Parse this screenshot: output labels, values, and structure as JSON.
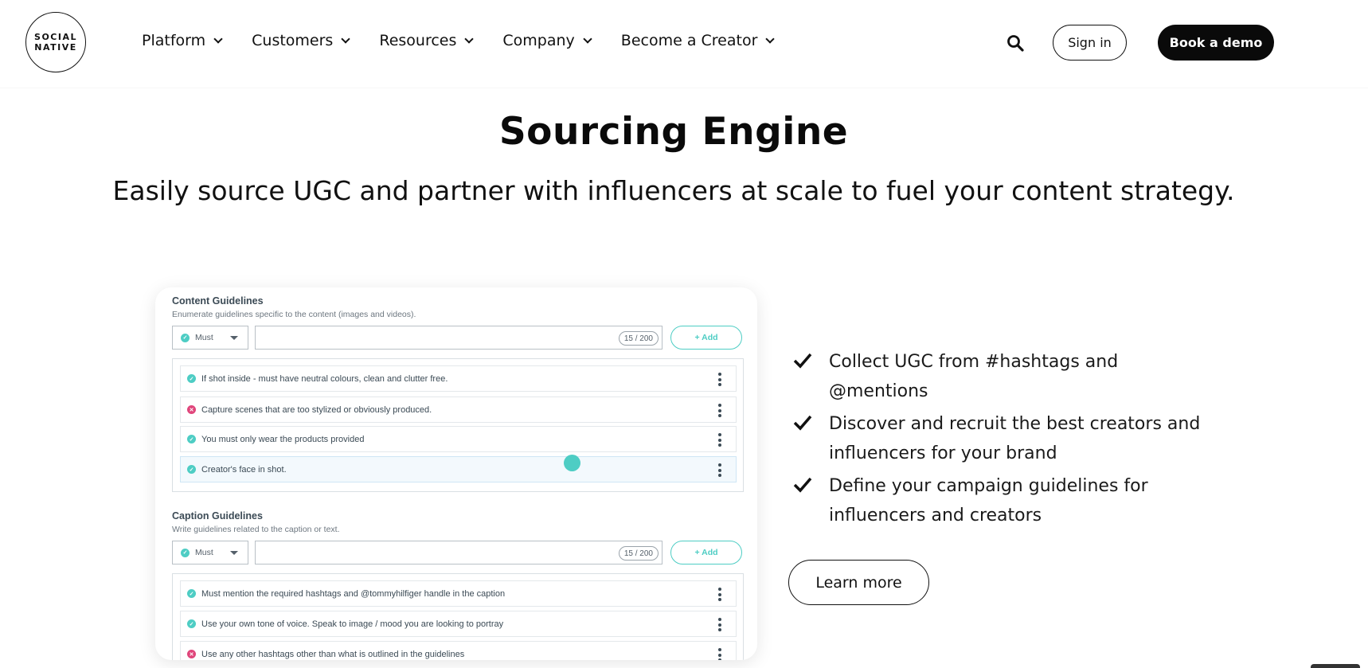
{
  "header": {
    "logo_line1": "SOCIAL",
    "logo_line2": "NATIVE",
    "nav": [
      {
        "label": "Platform"
      },
      {
        "label": "Customers"
      },
      {
        "label": "Resources"
      },
      {
        "label": "Company"
      },
      {
        "label": "Become a Creator"
      }
    ],
    "search_icon": "search-icon",
    "sign_in_label": "Sign in",
    "book_demo_label": "Book a demo"
  },
  "hero": {
    "title": "Sourcing Engine",
    "subtitle": "Easily source UGC and partner with influencers at scale to fuel your content strategy."
  },
  "app_card": {
    "content": {
      "title": "Content Guidelines",
      "description": "Enumerate guidelines specific to the content (images and videos).",
      "select_value": "Must",
      "counter": "15 / 200",
      "add_label": "+ Add",
      "items": [
        {
          "text": "If shot inside - must have neutral colours, clean and clutter free.",
          "status": "must"
        },
        {
          "text": "Capture scenes that are too stylized or obviously produced.",
          "status": "must-not"
        },
        {
          "text": "You must only wear the products provided",
          "status": "must"
        },
        {
          "text": "Creator's face in shot.",
          "status": "must"
        }
      ]
    },
    "caption": {
      "title": "Caption Guidelines",
      "description": "Write guidelines related to the caption or text.",
      "select_value": "Must",
      "counter": "15 / 200",
      "add_label": "+ Add",
      "items": [
        {
          "text": "Must mention the required hashtags and @tommyhilfiger handle in the caption",
          "status": "must"
        },
        {
          "text": "Use your own tone of voice. Speak to image / mood you are looking to portray",
          "status": "must"
        },
        {
          "text": "Use any other hashtags other than what is outlined in the guidelines",
          "status": "must-not"
        }
      ]
    },
    "colors": {
      "must": "#4ecdc4",
      "must_not": "#e0457b"
    }
  },
  "features": [
    "Collect UGC from #hashtags and @mentions",
    "Discover and recruit the best creators and influencers for your brand",
    "Define your campaign guidelines for influencers and creators"
  ],
  "learn_more_label": "Learn more"
}
